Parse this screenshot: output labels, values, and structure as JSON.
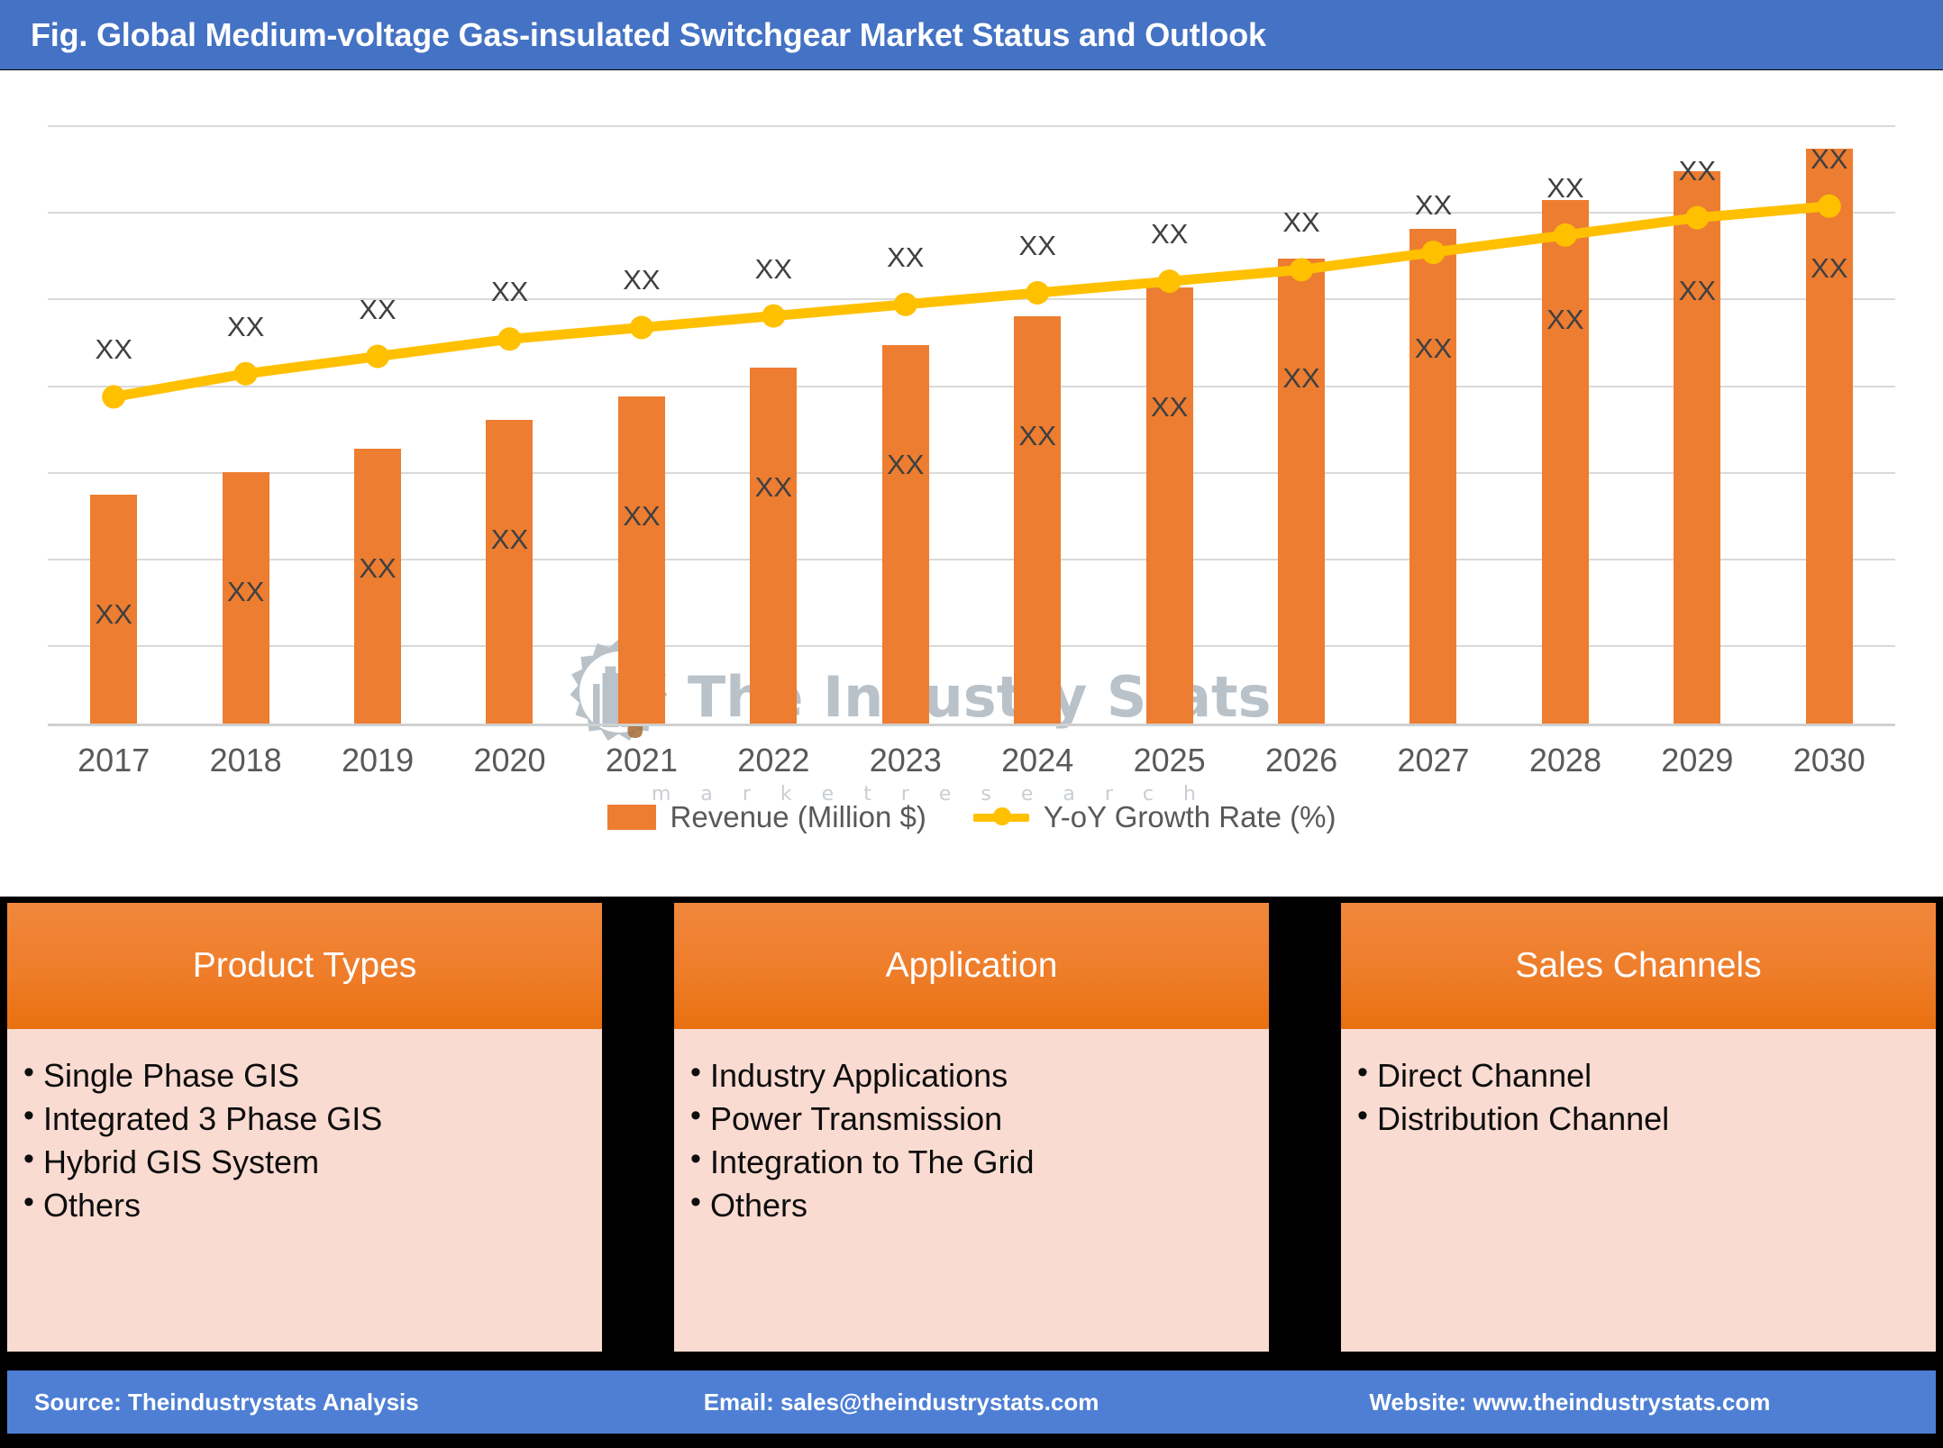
{
  "title": "Fig. Global Medium-voltage Gas-insulated Switchgear Market Status and Outlook",
  "watermark": {
    "brand": "The Industry Stats",
    "tagline": "m a r k e t   r e s e a r c h"
  },
  "chart_data": {
    "type": "bar",
    "title": "Fig. Global Medium-voltage Gas-insulated Switchgear Market Status and Outlook",
    "xlabel": "",
    "ylabel": "",
    "grid": true,
    "legend_position": "bottom",
    "categories": [
      "2017",
      "2018",
      "2019",
      "2020",
      "2021",
      "2022",
      "2023",
      "2024",
      "2025",
      "2026",
      "2027",
      "2028",
      "2029",
      "2030"
    ],
    "series": [
      {
        "name": "Revenue (Million $)",
        "type": "bar",
        "color": "#ed7d31",
        "values": [
          40,
          44,
          48,
          53,
          57,
          62,
          66,
          71,
          76,
          81,
          86,
          91,
          96,
          100
        ],
        "labels": [
          "XX",
          "XX",
          "XX",
          "XX",
          "XX",
          "XX",
          "XX",
          "XX",
          "XX",
          "XX",
          "XX",
          "XX",
          "XX",
          "XX"
        ]
      },
      {
        "name": "Y-oY Growth Rate (%)",
        "type": "line",
        "color": "#ffc000",
        "values": [
          57,
          61,
          64,
          67,
          69,
          71,
          73,
          75,
          77,
          79,
          82,
          85,
          88,
          90
        ],
        "labels": [
          "XX",
          "XX",
          "XX",
          "XX",
          "XX",
          "XX",
          "XX",
          "XX",
          "XX",
          "XX",
          "XX",
          "XX",
          "XX",
          "XX"
        ]
      }
    ],
    "ylim": [
      0,
      104
    ],
    "gridline_values": [
      104,
      89,
      74,
      59,
      44,
      29,
      14
    ]
  },
  "legend": [
    {
      "label": "Revenue (Million $)",
      "marker": "bar-swatch"
    },
    {
      "label": "Y-oY Growth Rate (%)",
      "marker": "line-marker"
    }
  ],
  "cards": [
    {
      "header": "Product Types",
      "items": [
        "Single Phase GIS",
        "Integrated 3 Phase GIS",
        "Hybrid GIS System",
        "Others"
      ]
    },
    {
      "header": "Application",
      "items": [
        "Industry Applications",
        "Power Transmission",
        "Integration to The Grid",
        "Others"
      ]
    },
    {
      "header": "Sales Channels",
      "items": [
        "Direct Channel",
        "Distribution Channel"
      ]
    }
  ],
  "footer": {
    "source": "Source: Theindustrystats Analysis",
    "email": "Email: sales@theindustrystats.com",
    "website": "Website: www.theindustrystats.com"
  },
  "colors": {
    "title_bar": "#4472c4",
    "footer_bar": "#4e7fd4",
    "bar": "#ed7d31",
    "line": "#ffc000",
    "card_body": "#fadbd2",
    "card_header": "#ef7d2a"
  }
}
